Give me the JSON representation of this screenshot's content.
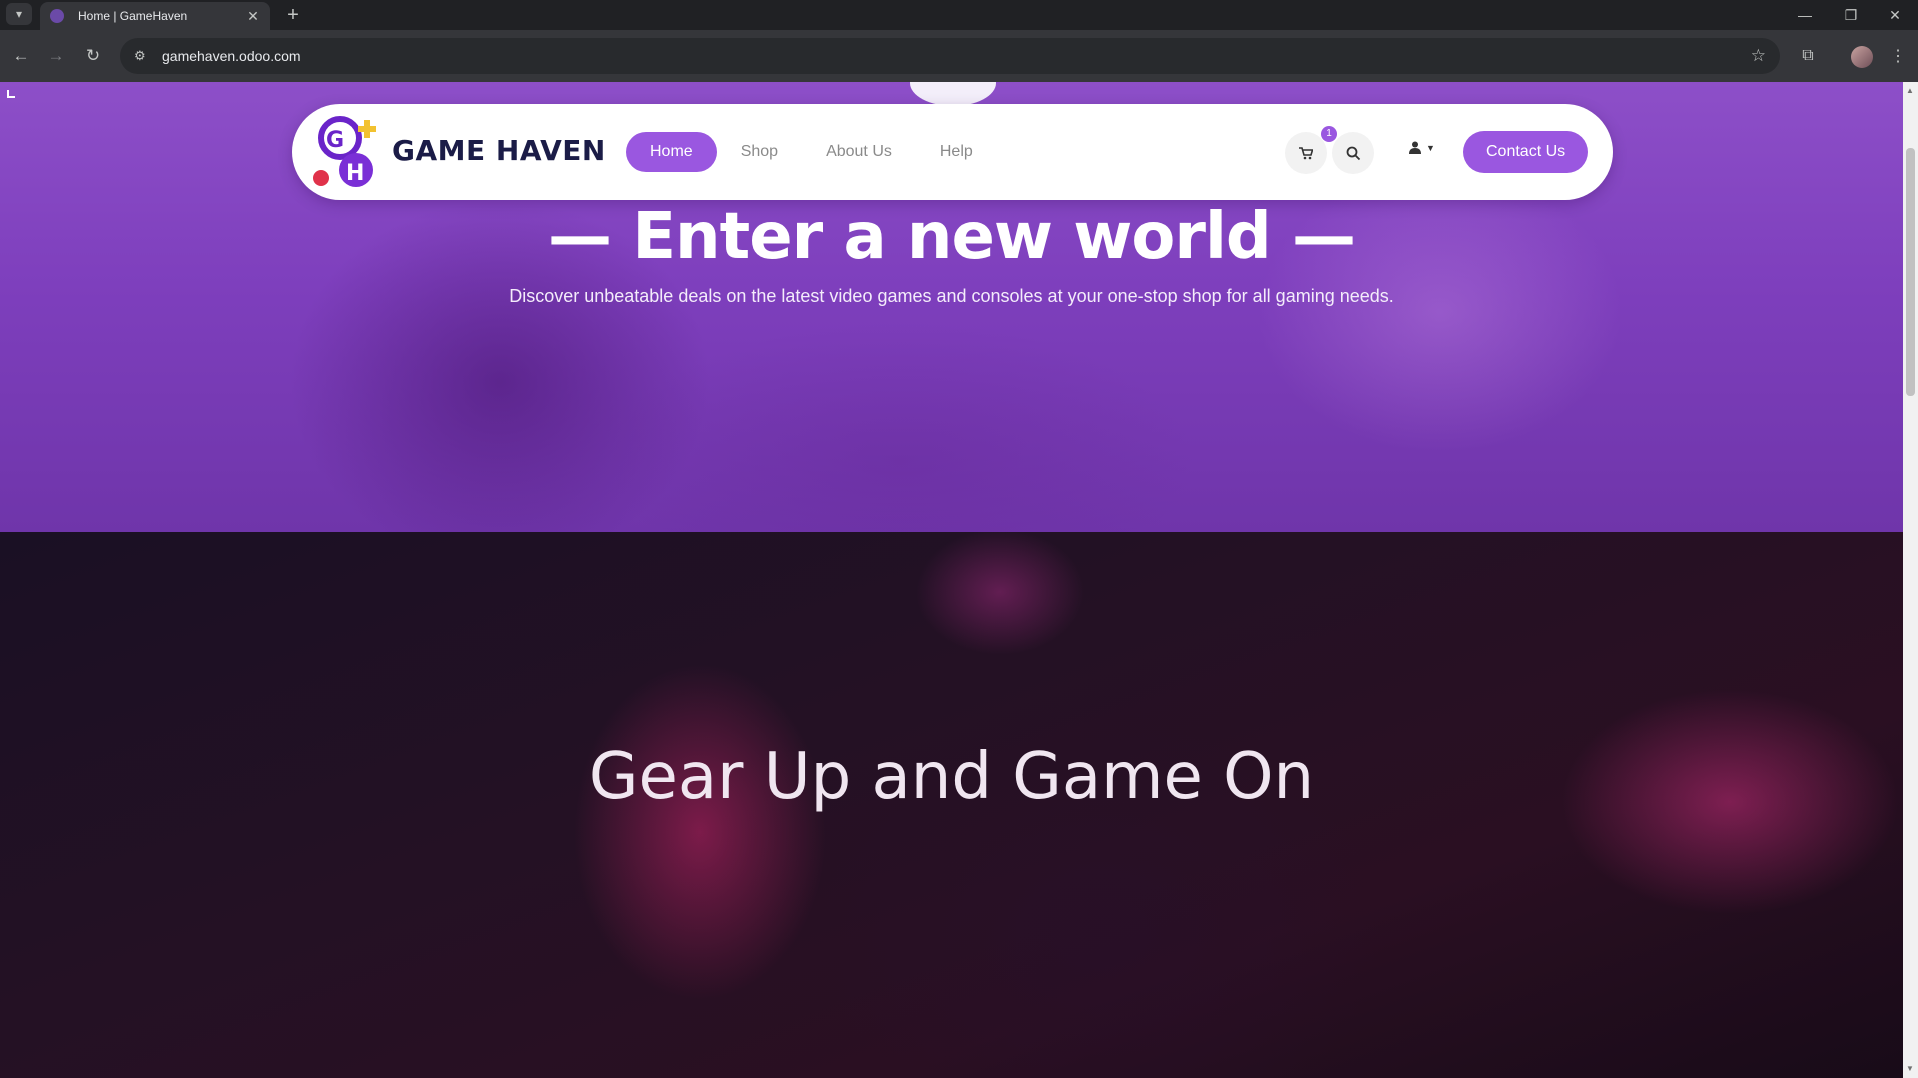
{
  "browser": {
    "tab_title": "Home | GameHaven",
    "url": "gamehaven.odoo.com"
  },
  "site": {
    "logo_text": "GAME HAVEN",
    "logo_letters": [
      "G",
      "H"
    ],
    "nav": [
      {
        "label": "Home",
        "active": true
      },
      {
        "label": "Shop",
        "active": false
      },
      {
        "label": "About Us",
        "active": false
      },
      {
        "label": "Help",
        "active": false
      }
    ],
    "cart_count": "1",
    "contact_label": "Contact Us",
    "accent_color": "#9a57e0"
  },
  "hero": {
    "title": "— Enter a new world —",
    "subtitle": "Discover unbeatable deals on the latest video games and consoles at your one-stop shop for all gaming needs."
  },
  "section2": {
    "title": "Gear Up and Game On"
  },
  "icons": [
    "chevron-down-icon",
    "close-icon",
    "plus-icon",
    "back-icon",
    "forward-icon",
    "reload-icon",
    "site-info-icon",
    "star-icon",
    "extensions-icon",
    "menu-icon",
    "cart-icon",
    "search-icon",
    "user-icon"
  ]
}
